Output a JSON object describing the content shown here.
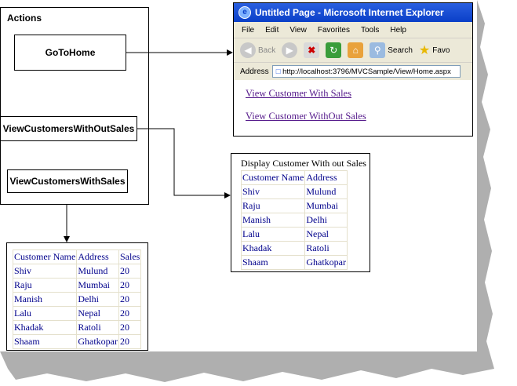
{
  "actions": {
    "title": "Actions",
    "goto_home": "GoToHome",
    "view_without_sales": "ViewCustomersWithOutSales",
    "view_with_sales": "ViewCustomersWithSales"
  },
  "browser": {
    "title": "Untitled Page - Microsoft Internet Explorer",
    "menu": [
      "File",
      "Edit",
      "View",
      "Favorites",
      "Tools",
      "Help"
    ],
    "toolbar": {
      "back": "Back",
      "search": "Search",
      "favorites": "Favo"
    },
    "address_label": "Address",
    "address_url": "http://localhost:3796/MVCSample/View/Home.aspx",
    "links": [
      "View Customer With Sales",
      "View Customer WithOut Sales"
    ]
  },
  "table_without_sales": {
    "caption": "Display Customer With out Sales",
    "headers": [
      "Customer Name",
      "Address"
    ],
    "rows": [
      [
        "Shiv",
        "Mulund"
      ],
      [
        "Raju",
        "Mumbai"
      ],
      [
        "Manish",
        "Delhi"
      ],
      [
        "Lalu",
        "Nepal"
      ],
      [
        "Khadak",
        "Ratoli"
      ],
      [
        "Shaam",
        "Ghatkopar"
      ]
    ]
  },
  "table_with_sales": {
    "headers": [
      "Customer Name",
      "Address",
      "Sales"
    ],
    "rows": [
      [
        "Shiv",
        "Mulund",
        "20"
      ],
      [
        "Raju",
        "Mumbai",
        "20"
      ],
      [
        "Manish",
        "Delhi",
        "20"
      ],
      [
        "Lalu",
        "Nepal",
        "20"
      ],
      [
        "Khadak",
        "Ratoli",
        "20"
      ],
      [
        "Shaam",
        "Ghatkopar",
        "20"
      ]
    ]
  },
  "colors": {
    "title_bar": "#0a3fc8",
    "link_visited": "#551a8b",
    "table_text": "#00008b"
  }
}
